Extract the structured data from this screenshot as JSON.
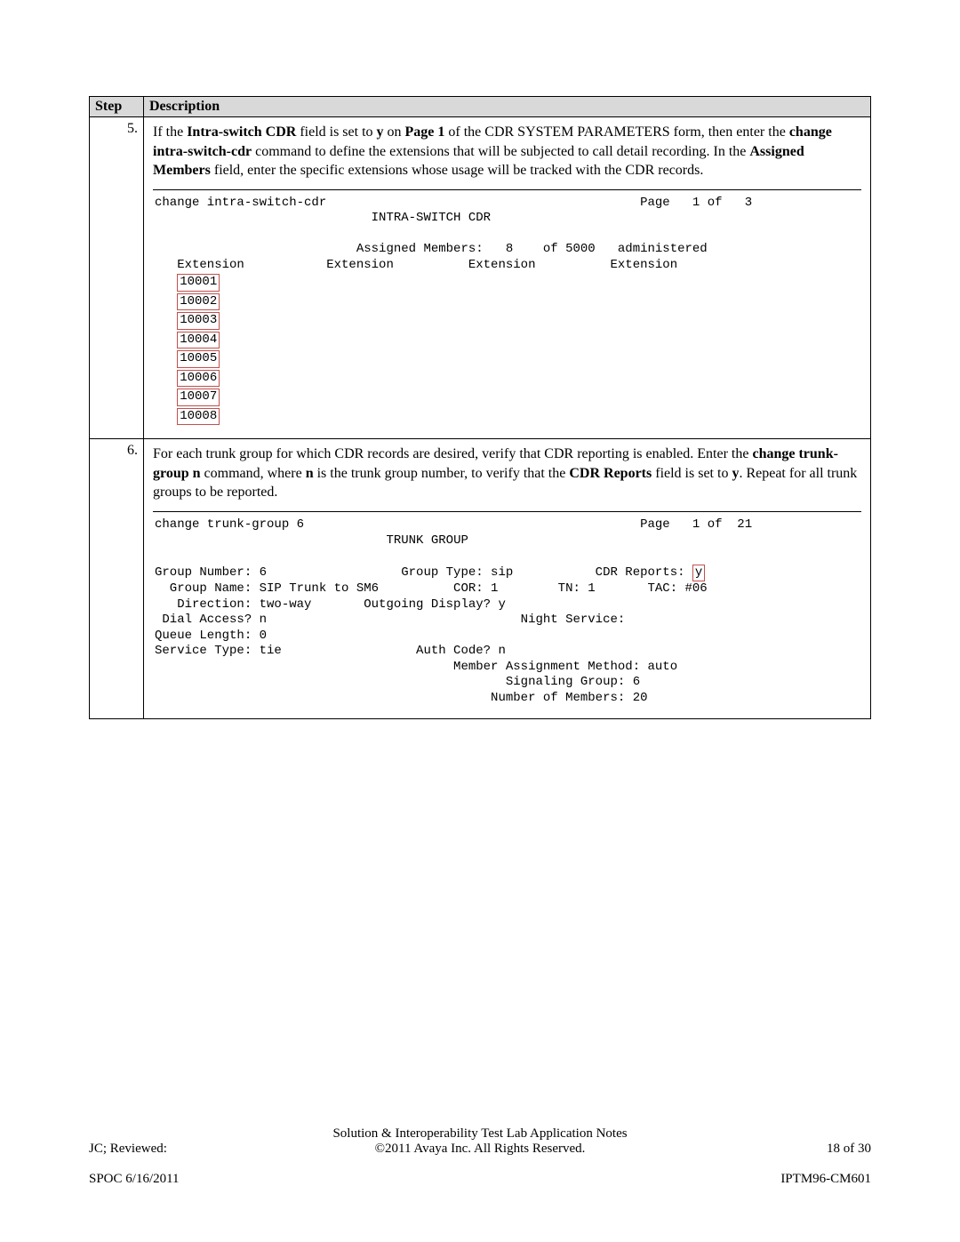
{
  "table": {
    "header": {
      "step": "Step",
      "description": "Description"
    },
    "rows": [
      {
        "num": "5.",
        "para_pre1": "If the ",
        "para_b1": "Intra-switch CDR",
        "para_mid1": " field is set to ",
        "para_b2": "y",
        "para_mid2": " on ",
        "para_b3": "Page 1",
        "para_mid3": " of the CDR SYSTEM PARAMETERS form, then enter the ",
        "para_b4": "change intra-switch-cdr",
        "para_mid4": " command to define the extensions that will be subjected to call detail recording. In the ",
        "para_b5": "Assigned Members",
        "para_mid5": " field, enter the specific extensions whose usage will be tracked with the CDR records.",
        "term": {
          "cmd": "change intra-switch-cdr",
          "page": "Page   1 of   3",
          "title": "INTRA-SWITCH CDR",
          "members_line": "Assigned Members:   8    of 5000   administered",
          "ext_headers": "   Extension           Extension          Extension          Extension",
          "extensions": [
            "10001",
            "10002",
            "10003",
            "10004",
            "10005",
            "10006",
            "10007",
            "10008"
          ]
        }
      },
      {
        "num": "6.",
        "para_pre1": "For each trunk group for which CDR records are desired, verify that CDR reporting is enabled. Enter the ",
        "para_b1": "change trunk-group n",
        "para_mid1": " command, where ",
        "para_b2": "n",
        "para_mid2": " is the trunk group number, to verify that the ",
        "para_b3": "CDR Reports",
        "para_mid3": " field is set to ",
        "para_b4": "y",
        "para_mid4": ". Repeat for all trunk groups to be reported.",
        "term": {
          "cmd": "change trunk-group 6",
          "page": "Page   1 of  21",
          "title": "TRUNK GROUP",
          "l1a": "Group Number: 6                  Group Type: sip           CDR Reports: ",
          "l1_box": "y",
          "l2": "  Group Name: SIP Trunk to SM6          COR: 1        TN: 1       TAC: #06",
          "l3": "   Direction: two-way       Outgoing Display? y",
          "l4": " Dial Access? n                                  Night Service:",
          "l5": "Queue Length: 0",
          "l6": "Service Type: tie                  Auth Code? n",
          "l7": "                                        Member Assignment Method: auto",
          "l8": "                                               Signaling Group: 6",
          "l9": "                                             Number of Members: 20"
        }
      }
    ]
  },
  "footer": {
    "left1": "JC; Reviewed:",
    "left2": "SPOC 6/16/2011",
    "center1": "Solution & Interoperability Test Lab Application Notes",
    "center2": "©2011 Avaya Inc. All Rights Reserved.",
    "right1": "18 of 30",
    "right2": "IPTM96-CM601"
  }
}
